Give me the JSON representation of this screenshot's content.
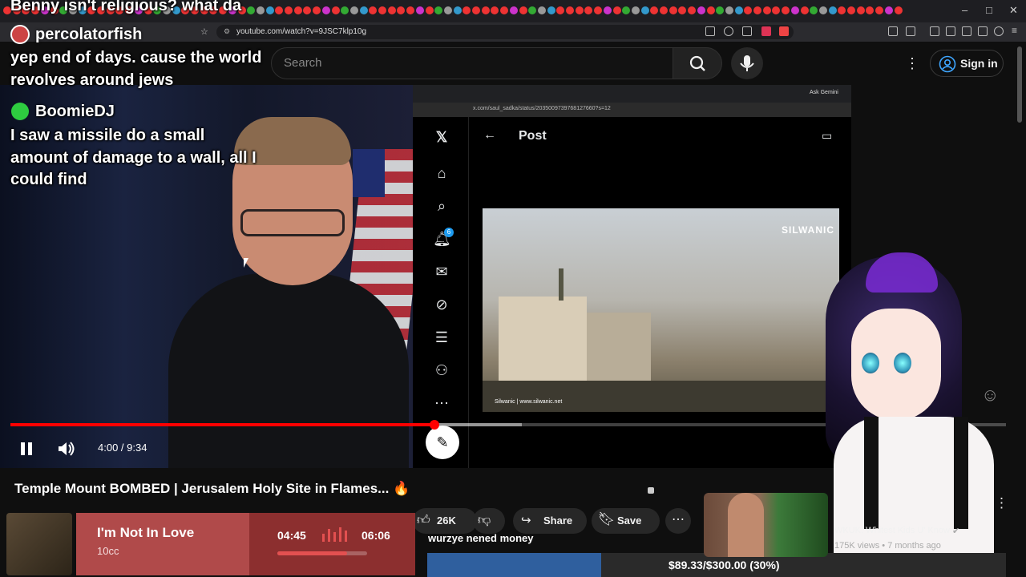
{
  "browser": {
    "url": "youtube.com/watch?v=9JSC7klp10g"
  },
  "overlay": {
    "top_chat_text": "Benny isn't religious? what da",
    "channel_name": "percolatorfish",
    "chat": [
      {
        "text_lines": [
          "yep end of days. cause the world",
          "revolves around jews"
        ]
      },
      {
        "user": "BoomieDJ",
        "text_lines": [
          "I saw a missile do a small",
          "amount of damage to a wall, all I",
          "could find"
        ]
      }
    ]
  },
  "youtube": {
    "search_placeholder": "Search",
    "signin_label": "Sign in",
    "video_title": "Temple Mount BOMBED | Jerusalem Holy Site in Flames... 🔥",
    "player": {
      "time_current": "4:00",
      "time_separator": " / ",
      "time_total": "9:34",
      "progress_fraction": 0.4262,
      "buffer_fraction": 0.514
    },
    "actions": {
      "like_count": "26K",
      "share_label": "Share",
      "save_label": "Save"
    },
    "recommendation": {
      "title": "WKUK: Whitest Kids U' Know",
      "meta": "175K views • 7 months ago"
    }
  },
  "embedded_x": {
    "url": "x.com/saul_sadka/status/2035009739768127660?s=12",
    "ask_label": "Ask Gemini",
    "page_title": "Post",
    "notification_count": "6",
    "media_watermark": "SILWANIC",
    "media_credit": "Silwanic  |  www.silwanic.net"
  },
  "music_widget": {
    "title": "I'm Not In Love",
    "artist": "10cc",
    "elapsed": "04:45",
    "duration": "06:06",
    "progress_fraction": 0.778
  },
  "donation": {
    "note": "wurzye nened money",
    "text": "$89.33/$300.00 (30%)",
    "fraction": 0.3
  },
  "colors": {
    "youtube_red": "#ff0000",
    "x_blue": "#1d9bf0",
    "music_panel": "#b04a4a",
    "donation_fill": "#2f5f9e"
  }
}
